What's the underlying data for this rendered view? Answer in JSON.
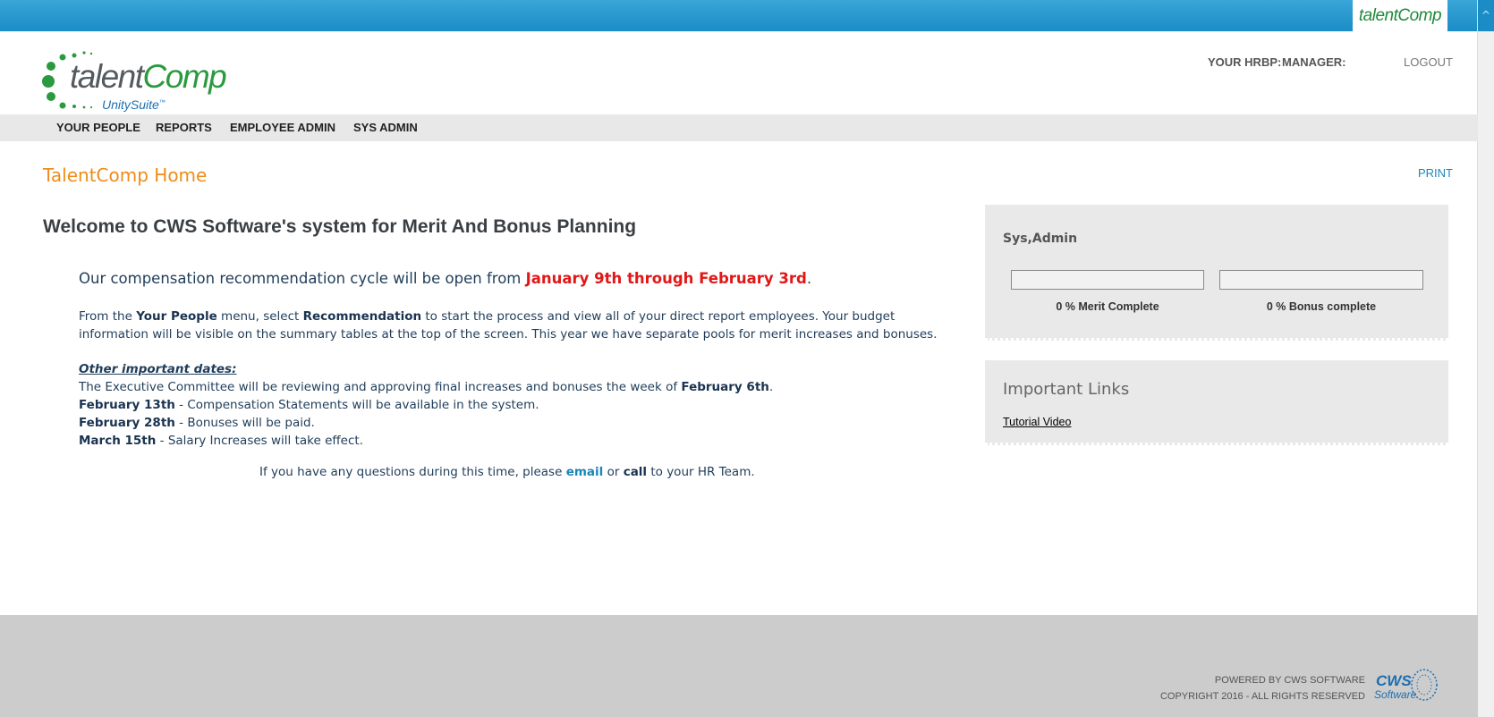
{
  "topbar": {
    "tab_label": "talentComp"
  },
  "logo": {
    "word_part1": "talent",
    "word_part2": "Comp",
    "sub": "UnitySuite",
    "sub_mark": "™"
  },
  "header": {
    "hrbp_label": "YOUR HRBP:",
    "manager_label": "MANAGER:",
    "logout_label": "LOGOUT"
  },
  "nav": {
    "items": [
      "YOUR PEOPLE",
      "REPORTS",
      "EMPLOYEE ADMIN",
      "SYS ADMIN"
    ]
  },
  "page": {
    "title": "TalentComp Home",
    "print_label": "PRINT",
    "welcome": "Welcome to CWS Software's system for Merit And Bonus Planning",
    "cycle_text": "Our compensation recommendation cycle will be open from ",
    "cycle_dates": "January 9th through February 3rd",
    "cycle_end": ".",
    "intro": {
      "p1": "From the ",
      "b1": "Your People",
      "p2": " menu, select ",
      "b2": "Recommendation",
      "p3": " to start the process and view all of your direct report employees.  Your budget information will be visible on the summary tables at the top of the screen.  This year we have separate pools for merit increases and bonuses."
    },
    "dates": {
      "title": "Other important dates:",
      "line1_text": "The Executive Committee will be reviewing and approving final increases and bonuses the week of ",
      "line1_date": "February 6th",
      "line1_end": ".",
      "line2_date": "February 13th",
      "line2_text": " - Compensation Statements will be available in the system.",
      "line3_date": "February 28th",
      "line3_text": " - Bonuses will be paid.",
      "line4_date": "March 15th",
      "line4_text": " - Salary Increases will take effect."
    },
    "questions": {
      "p1": "If you have any questions during this time, please ",
      "email": "email",
      "p2": " or ",
      "call": "call",
      "p3": " to your HR Team."
    }
  },
  "status_panel": {
    "user": "Sys,Admin",
    "merit_label": "0 % Merit Complete",
    "merit_progress": 0,
    "bonus_label": "0 % Bonus complete",
    "bonus_progress": 0
  },
  "links_panel": {
    "title": "Important Links",
    "links": [
      "Tutorial Video"
    ]
  },
  "footer": {
    "powered": "POWERED BY CWS SOFTWARE",
    "copyright": "COPYRIGHT 2016 - ALL RIGHTS RESERVED",
    "logo_word1": "CWS",
    "logo_word2": "Software"
  },
  "colors": {
    "accent_blue": "#1b8cc6",
    "brand_green": "#2b9a3f",
    "title_orange": "#ef8c1a",
    "highlight_red": "#e01818"
  }
}
